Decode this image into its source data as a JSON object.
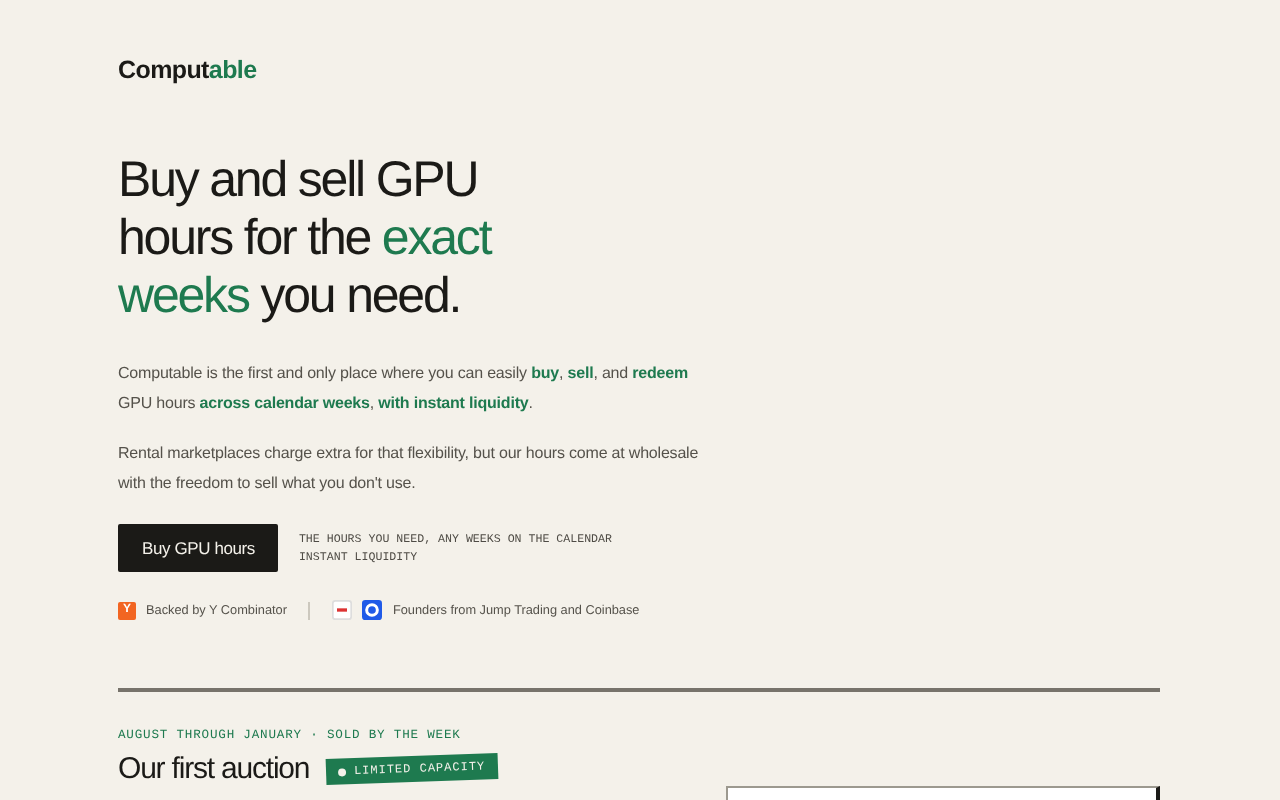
{
  "logo": {
    "parts": [
      {
        "text": "Comput",
        "accent": false
      },
      {
        "text": "able",
        "accent": true
      }
    ]
  },
  "headline": [
    [
      {
        "text": "Buy and sell GPU",
        "accent": false
      }
    ],
    [
      {
        "text": "hours for the ",
        "accent": false
      },
      {
        "text": "exact",
        "accent": true
      }
    ],
    [
      {
        "text": "weeks",
        "accent": true
      },
      {
        "text": " you need.",
        "accent": false
      }
    ]
  ],
  "paragraphs": [
    [
      {
        "text": "Computable is the first and only place where you can easily ",
        "accent": false
      },
      {
        "text": "buy",
        "accent": true
      },
      {
        "text": ", ",
        "accent": false
      },
      {
        "text": "sell",
        "accent": true
      },
      {
        "text": ", and ",
        "accent": false
      },
      {
        "text": "redeem",
        "accent": true
      },
      {
        "text": " GPU hours ",
        "accent": false
      },
      {
        "text": "across calendar weeks",
        "accent": true
      },
      {
        "text": ", ",
        "accent": false
      },
      {
        "text": "with instant liquidity",
        "accent": true
      },
      {
        "text": ".",
        "accent": false
      }
    ],
    [
      {
        "text": "Rental marketplaces charge extra for that flexibility, but our hours come at wholesale with the freedom to sell what you don't use.",
        "accent": false
      }
    ]
  ],
  "cta": {
    "button": "Buy GPU hours",
    "notes": [
      "THE HOURS YOU NEED, ANY WEEKS ON THE CALENDAR",
      "INSTANT LIQUIDITY"
    ]
  },
  "backers": [
    {
      "kind": "yc",
      "icon_text": "Y",
      "label": "Backed by Y Combinator"
    },
    {
      "kind": "founders",
      "label": "Founders from Jump Trading and Coinbase"
    }
  ],
  "auction": {
    "kicker": "AUGUST THROUGH JANUARY · SOLD BY THE WEEK",
    "title": "Our first auction",
    "tag": "LIMITED CAPACITY"
  }
}
